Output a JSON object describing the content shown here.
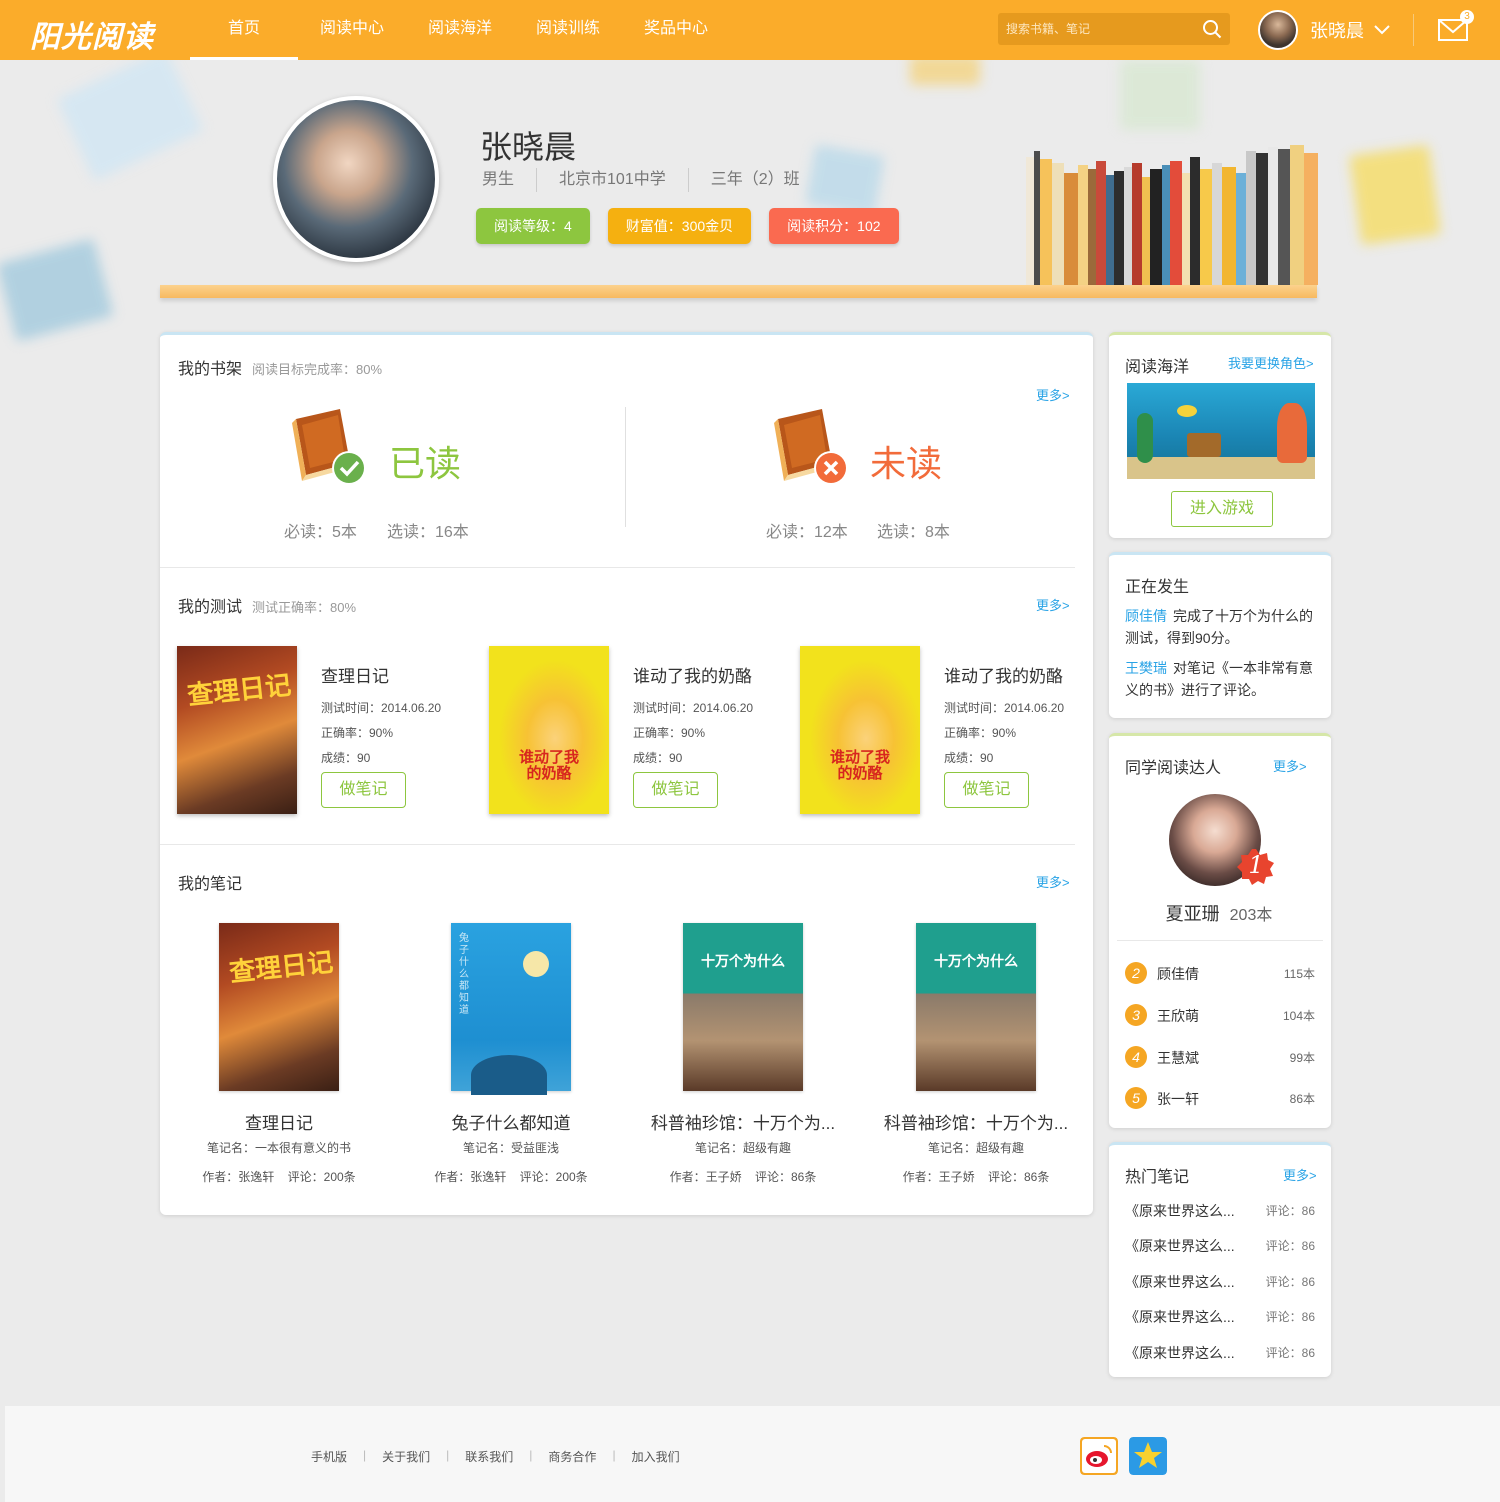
{
  "app": {
    "logo_text": "阳光阅读"
  },
  "nav": {
    "items": [
      {
        "label": "首页",
        "active": true
      },
      {
        "label": "阅读中心"
      },
      {
        "label": "阅读海洋"
      },
      {
        "label": "阅读训练"
      },
      {
        "label": "奖品中心"
      }
    ]
  },
  "search": {
    "placeholder": "搜索书籍、笔记",
    "value": ""
  },
  "user": {
    "name": "张晓晨",
    "mail_count": "3"
  },
  "colors": {
    "accent": "#fbac2a",
    "green": "#8dc63f",
    "link": "#29a3e6",
    "orange_red": "#f26b3a"
  },
  "profile": {
    "name": "张晓晨",
    "gender": "男生",
    "school": "北京市101中学",
    "class": "三年（2）班",
    "badges": [
      {
        "label": "阅读等级：4",
        "color": "#8dc63f"
      },
      {
        "label": "财富值：300金贝",
        "color": "#f5b010"
      },
      {
        "label": "阅读积分：102",
        "color": "#fa6a50"
      }
    ]
  },
  "bookshelf": {
    "title": "我的书架",
    "subtitle": "阅读目标完成率：80%",
    "more": "更多>",
    "read": {
      "label": "已读",
      "required": "必读：5本",
      "optional": "选读：16本"
    },
    "unread": {
      "label": "未读",
      "required": "必读：12本",
      "optional": "选读：8本"
    }
  },
  "tests": {
    "title": "我的测试",
    "subtitle": "测试正确率：80%",
    "more": "更多>",
    "items": [
      {
        "title": "查理日记",
        "time": "测试时间：2014.06.20",
        "accuracy": "正确率：90%",
        "score": "成绩：90",
        "button": "做笔记",
        "cover": "charlie"
      },
      {
        "title": "谁动了我的奶酪",
        "time": "测试时间：2014.06.20",
        "accuracy": "正确率：90%",
        "score": "成绩：90",
        "button": "做笔记",
        "cover": "cheese"
      },
      {
        "title": "谁动了我的奶酪",
        "time": "测试时间：2014.06.20",
        "accuracy": "正确率：90%",
        "score": "成绩：90",
        "button": "做笔记",
        "cover": "cheese"
      }
    ]
  },
  "notes": {
    "title": "我的笔记",
    "more": "更多>",
    "items": [
      {
        "title": "查理日记",
        "note_name": "笔记名：一本很有意义的书",
        "author": "作者：张逸轩",
        "comments": "评论：200条",
        "cover": "charlie"
      },
      {
        "title": "兔子什么都知道",
        "note_name": "笔记名：受益匪浅",
        "author": "作者：张逸轩",
        "comments": "评论：200条",
        "cover": "rabbit"
      },
      {
        "title": "科普袖珍馆：十万个为...",
        "note_name": "笔记名：超级有趣",
        "author": "作者：王子娇",
        "comments": "评论：86条",
        "cover": "why"
      },
      {
        "title": "科普袖珍馆：十万个为...",
        "note_name": "笔记名：超级有趣",
        "author": "作者：王子娇",
        "comments": "评论：86条",
        "cover": "why"
      }
    ]
  },
  "ocean": {
    "title": "阅读海洋",
    "link": "我要更换角色>",
    "button": "进入游戏"
  },
  "happening": {
    "title": "正在发生",
    "items": [
      {
        "who": "顾佳倩",
        "text": "完成了十万个为什么的测试，得到90分。"
      },
      {
        "who": "王樊瑞",
        "text": "对笔记《一本非常有意义的书》进行了评论。"
      }
    ]
  },
  "readers": {
    "title": "同学阅读达人",
    "more": "更多>",
    "top": {
      "rank": "1",
      "name": "夏亚珊",
      "count": "203本"
    },
    "list": [
      {
        "rank": "2",
        "name": "顾佳倩",
        "count": "115本"
      },
      {
        "rank": "3",
        "name": "王欣萌",
        "count": "104本"
      },
      {
        "rank": "4",
        "name": "王慧斌",
        "count": "99本"
      },
      {
        "rank": "5",
        "name": "张一轩",
        "count": "86本"
      }
    ]
  },
  "hot_notes": {
    "title": "热门笔记",
    "more": "更多>",
    "items": [
      {
        "title": "《原来世界这么...",
        "comments": "评论：86"
      },
      {
        "title": "《原来世界这么...",
        "comments": "评论：86"
      },
      {
        "title": "《原来世界这么...",
        "comments": "评论：86"
      },
      {
        "title": "《原来世界这么...",
        "comments": "评论：86"
      },
      {
        "title": "《原来世界这么...",
        "comments": "评论：86"
      }
    ]
  },
  "footer": {
    "links": [
      "手机版",
      "关于我们",
      "联系我们",
      "商务合作",
      "加入我们"
    ],
    "social": [
      "weibo-icon",
      "qzone-icon"
    ]
  }
}
